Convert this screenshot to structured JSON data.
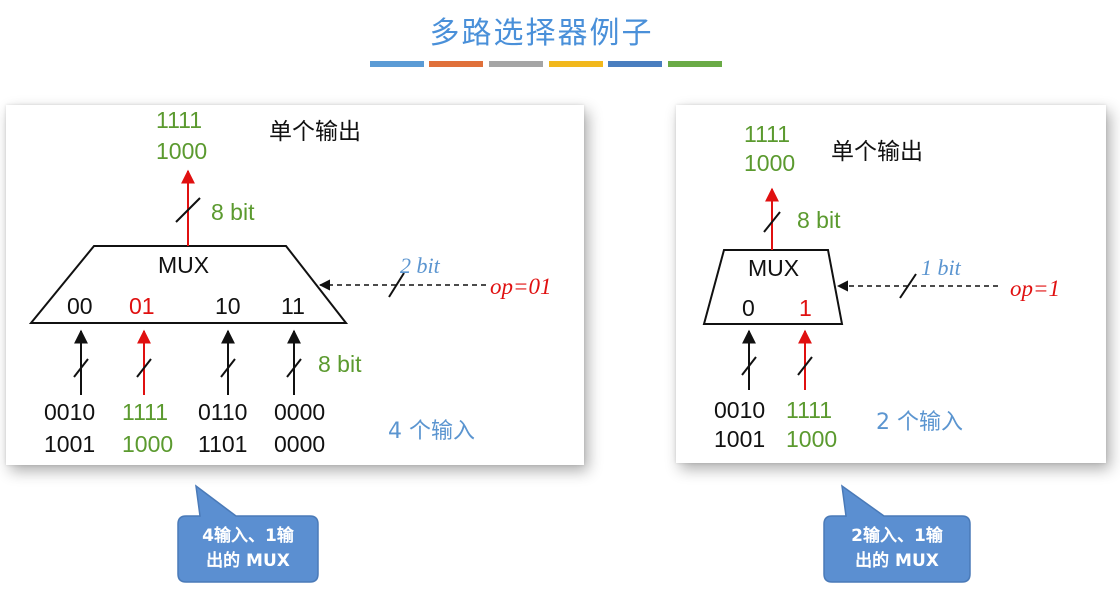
{
  "title": "多路选择器例子",
  "color_bars": [
    "#5b9bd5",
    "#e0703a",
    "#a5a5a5",
    "#f2b81c",
    "#4a7ebf",
    "#6aab46"
  ],
  "left_example": {
    "output_values": [
      "1111",
      "1000"
    ],
    "heading": "单个输出",
    "output_width": "8 bit",
    "mux_label": "MUX",
    "select_width": "2 bit",
    "select_value": "op=01",
    "ports": [
      "00",
      "01",
      "10",
      "11"
    ],
    "input_width": "8 bit",
    "inputs": [
      [
        "0010",
        "1001"
      ],
      [
        "1111",
        "1000"
      ],
      [
        "0110",
        "1101"
      ],
      [
        "0000",
        "0000"
      ]
    ],
    "input_count_label": "4 个输入",
    "callout": [
      "4输入、1输",
      "出的 MUX"
    ]
  },
  "right_example": {
    "output_values": [
      "1111",
      "1000"
    ],
    "heading": "单个输出",
    "output_width": "8 bit",
    "mux_label": "MUX",
    "select_width": "1 bit",
    "select_value": "op=1",
    "ports": [
      "0",
      "1"
    ],
    "inputs": [
      [
        "0010",
        "1001"
      ],
      [
        "1111",
        "1000"
      ]
    ],
    "input_count_label": "2 个输入",
    "callout": [
      "2输入、1输",
      "出的 MUX"
    ]
  }
}
